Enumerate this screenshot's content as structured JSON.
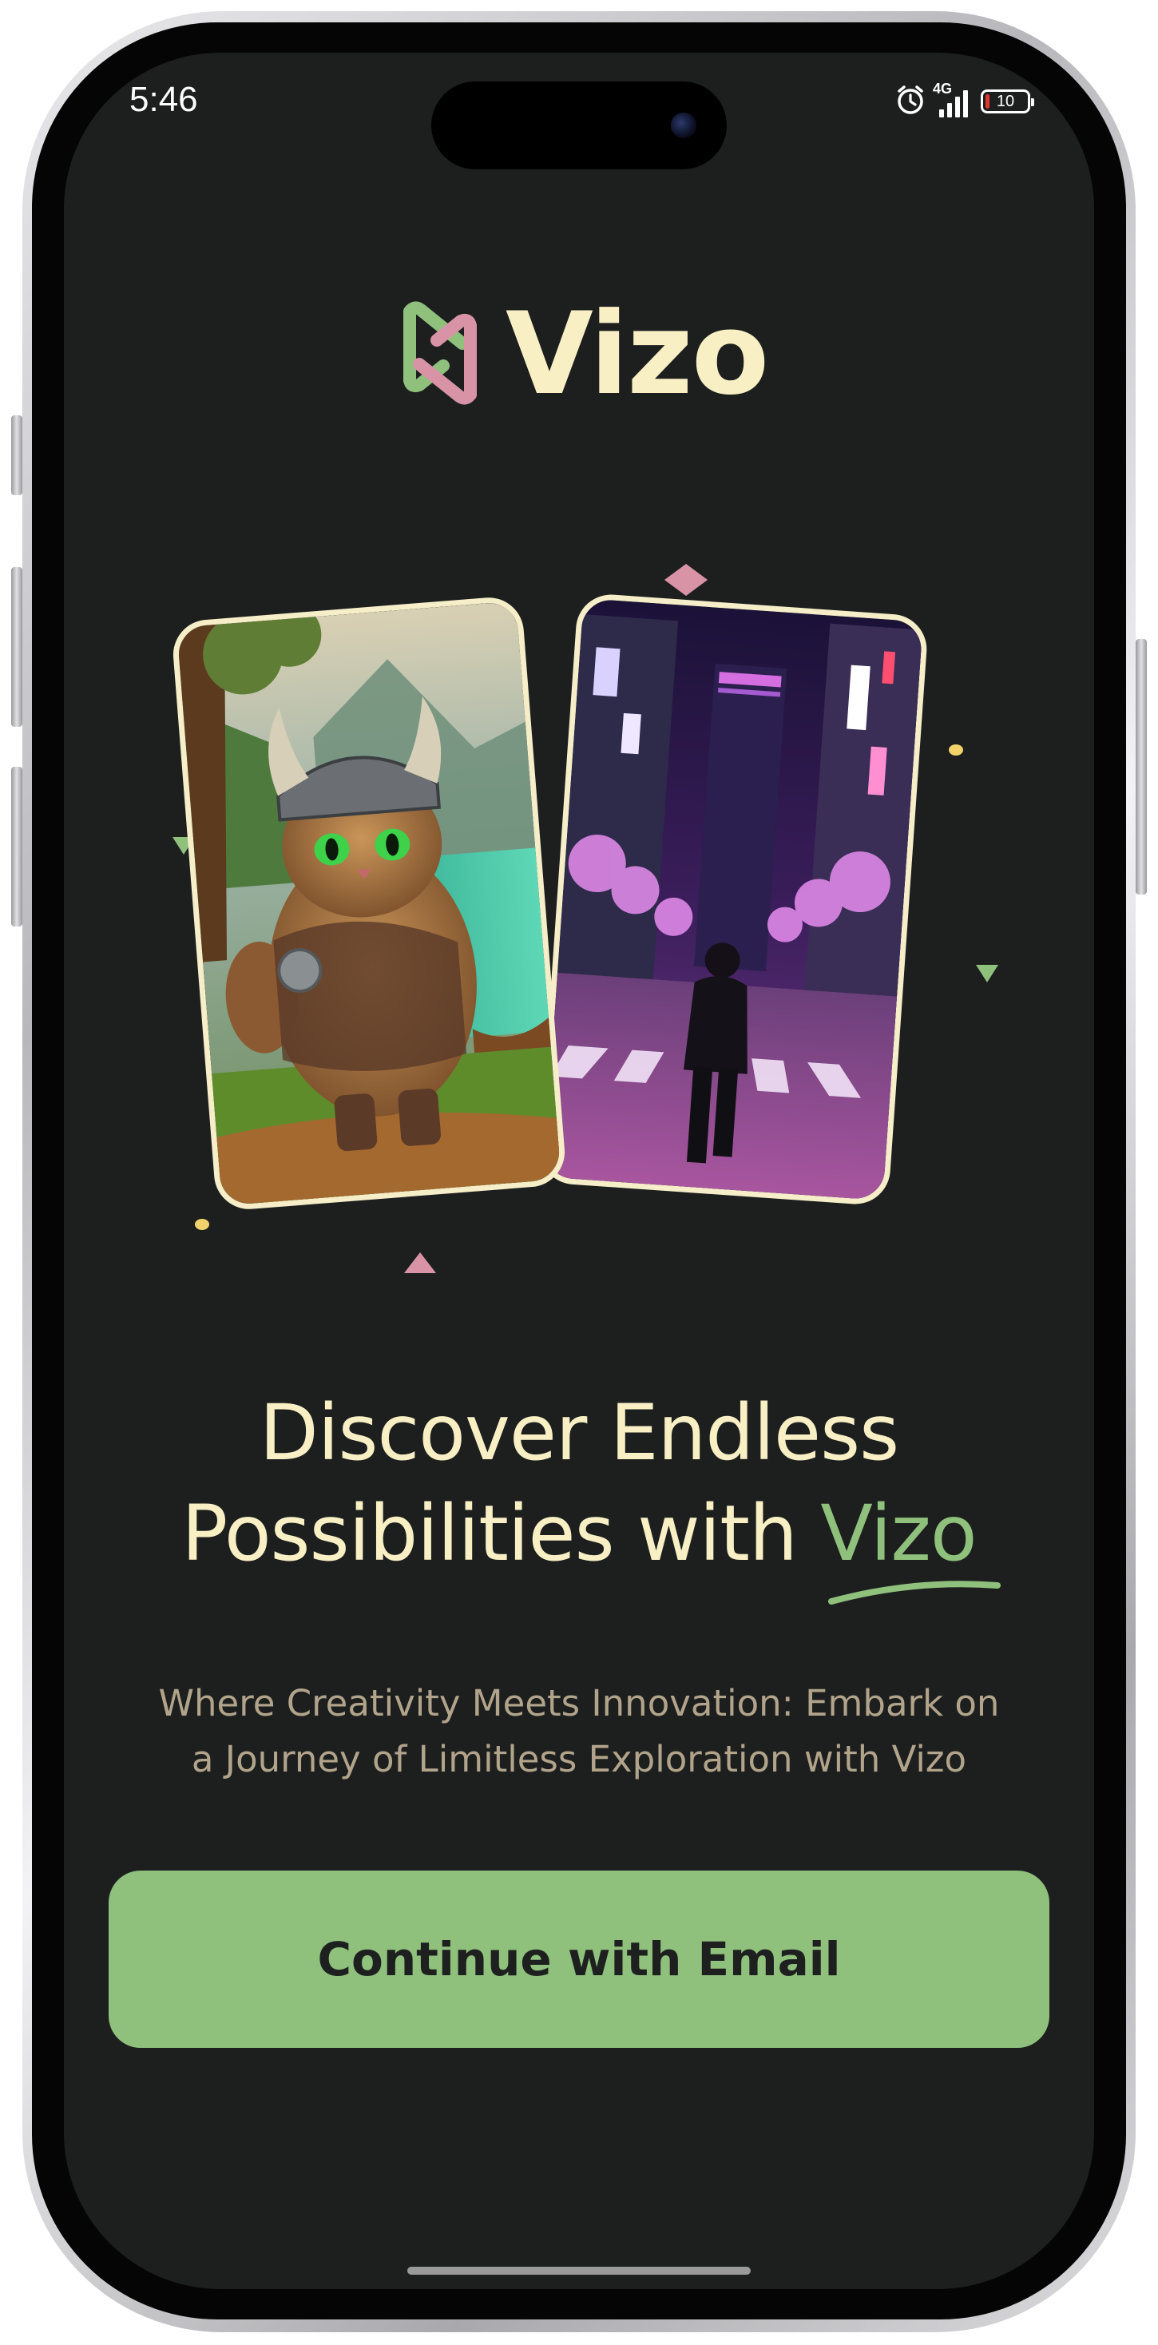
{
  "status_bar": {
    "time": "5:46",
    "network": "4G",
    "battery": {
      "level": "10",
      "fraction": 0.1,
      "color": "#e0382f"
    },
    "icons": [
      "alarm-icon",
      "signal-icon",
      "battery-icon"
    ]
  },
  "brand": {
    "name": "Vizo",
    "logo_icon": "vizo-logo-icon",
    "colors": {
      "green": "#8fc07c",
      "pink": "#d894a6",
      "cream": "#f8efc4"
    }
  },
  "showcase": {
    "cards": [
      {
        "name": "viking-cat-artwork",
        "description_icon": "image"
      },
      {
        "name": "neon-city-artwork",
        "description_icon": "image"
      }
    ]
  },
  "headline": {
    "line1": "Discover Endless",
    "line2_prefix": "Possibilities with ",
    "line2_brand": "Vizo"
  },
  "subtitle": "Where Creativity Meets Innovation: Embark on a Journey of Limitless Exploration with Vizo",
  "cta": {
    "label": "Continue with Email",
    "color": "#8fc07c"
  },
  "theme": {
    "background": "#1d1f1f",
    "text_primary": "#f8efc4",
    "text_secondary": "#b2a48b"
  }
}
